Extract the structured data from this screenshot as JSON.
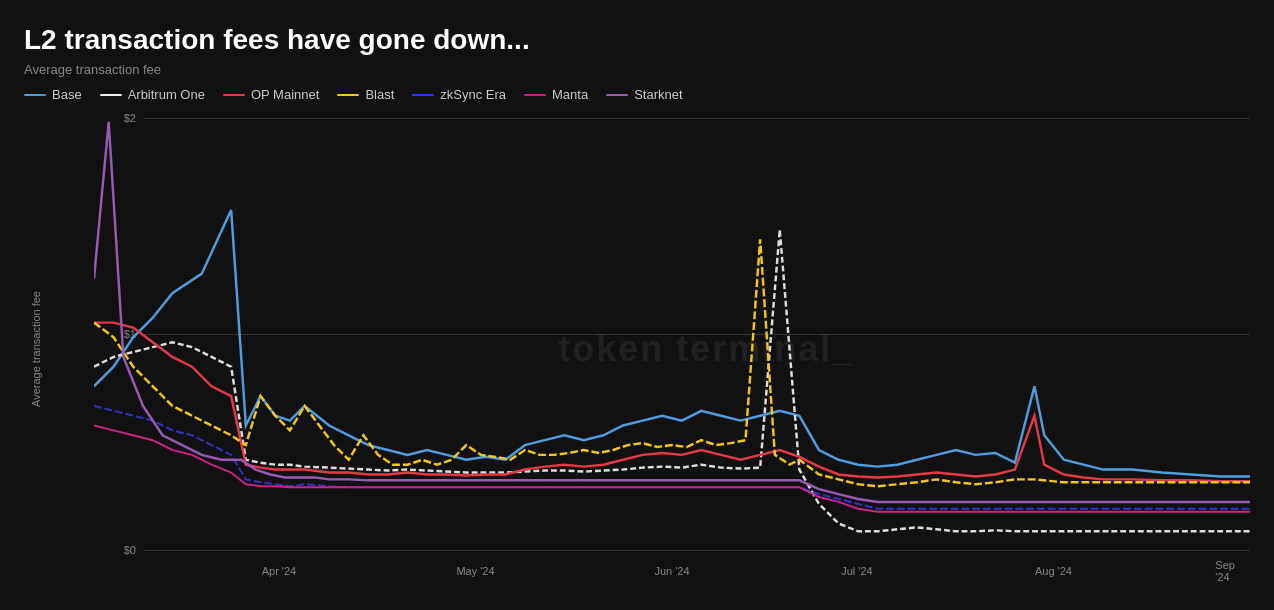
{
  "title": "L2 transaction fees have gone down...",
  "subtitle": "Average transaction fee",
  "y_axis_label": "Average transaction fee",
  "watermark": "token terminal_",
  "y_axis": {
    "labels": [
      "$2",
      "$1",
      "$0"
    ],
    "values": [
      2,
      1,
      0
    ]
  },
  "x_axis": {
    "labels": [
      "Apr '24",
      "May '24",
      "Jun '24",
      "Jul '24",
      "Aug '24",
      "Sep '24"
    ],
    "positions": [
      16,
      33,
      50,
      67,
      83,
      98
    ]
  },
  "legend": [
    {
      "name": "Base",
      "color": "#4d9de0",
      "dash": false
    },
    {
      "name": "Arbitrum One",
      "color": "#eeeeee",
      "dash": true
    },
    {
      "name": "OP Mainnet",
      "color": "#e63946",
      "dash": false
    },
    {
      "name": "Blast",
      "color": "#f5c518",
      "dash": true
    },
    {
      "name": "zkSync Era",
      "color": "#1a1aff",
      "dash": true
    },
    {
      "name": "Manta",
      "color": "#cc2288",
      "dash": false
    },
    {
      "name": "Starknet",
      "color": "#9b59b6",
      "dash": false
    }
  ]
}
